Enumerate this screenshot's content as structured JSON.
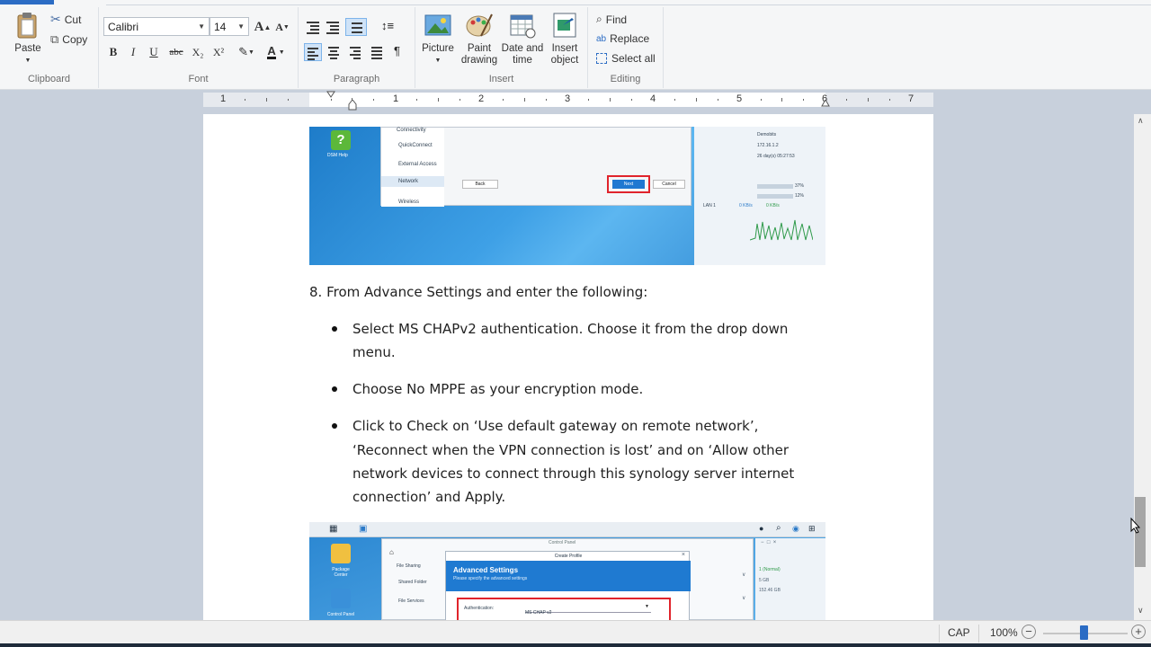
{
  "ribbon": {
    "clipboard": {
      "group_label": "Clipboard",
      "paste": "Paste",
      "cut": "Cut",
      "copy": "Copy"
    },
    "font": {
      "group_label": "Font",
      "font_name": "Calibri",
      "font_size": "14",
      "bold": "B",
      "italic": "I",
      "underline": "U",
      "strikethrough": "abc",
      "subscript": "X₂",
      "superscript": "X²"
    },
    "paragraph": {
      "group_label": "Paragraph"
    },
    "insert": {
      "group_label": "Insert",
      "picture": "Picture",
      "paint_drawing_l1": "Paint",
      "paint_drawing_l2": "drawing",
      "datetime_l1": "Date and",
      "datetime_l2": "time",
      "insert_object_l1": "Insert",
      "insert_object_l2": "object"
    },
    "editing": {
      "group_label": "Editing",
      "find": "Find",
      "replace": "Replace",
      "select_all": "Select all"
    }
  },
  "ruler": {
    "numbers": [
      "1",
      "1",
      "2",
      "3",
      "4",
      "5",
      "6",
      "7"
    ]
  },
  "document": {
    "step8": "8. From Advance Settings and enter the following:",
    "bullet1_l1": "Select MS CHAPv2 authentication. Choose it from the drop down",
    "bullet1_l2": "menu.",
    "bullet2": "Choose No MPPE as your encryption mode.",
    "bullet3_l1": "Click to Check on ‘Use default gateway on remote network’,",
    "bullet3_l2": "‘Reconnect when the VPN connection is lost’ and on ‘Allow other",
    "bullet3_l3": "network devices to connect through this synology server internet",
    "bullet3_l4": "connection’ and Apply.",
    "shot1": {
      "sidebar_items": [
        "Connectivity",
        "QuickConnect",
        "External Access",
        "Network",
        "Wireless"
      ],
      "help_label": "DSM Help",
      "back_button": "Back",
      "next_button": "Next",
      "cancel_button": "Cancel",
      "widget_lines": [
        "Demobits",
        "172.16.1.2",
        "26 day(s) 05:27:53"
      ],
      "percent1": "37%",
      "percent2": "12%",
      "speed1": "0 KB/s",
      "speed2": "0 KB/s",
      "lan_label": "LAN 1"
    },
    "shot2": {
      "window_title": "Control Panel",
      "dialog_title": "Create Profile",
      "advanced_heading": "Advanced Settings",
      "advanced_sub": "Please specify the advanced settings",
      "auth_label": "Authentication:",
      "auth_value": "MS CHAP v2",
      "nav_items": [
        "File Sharing",
        "Shared Folder",
        "File Services"
      ],
      "desk_icons": [
        "Package Center",
        "Control Panel"
      ],
      "status_normal": "1 (Normal)",
      "size1": "5 GB",
      "size2": "152.46 GB"
    }
  },
  "statusbar": {
    "caps": "CAP",
    "zoom": "100%"
  },
  "colors": {
    "accent": "#2b6cc4",
    "highlight_red": "#e0242c",
    "page": "#ffffff"
  }
}
